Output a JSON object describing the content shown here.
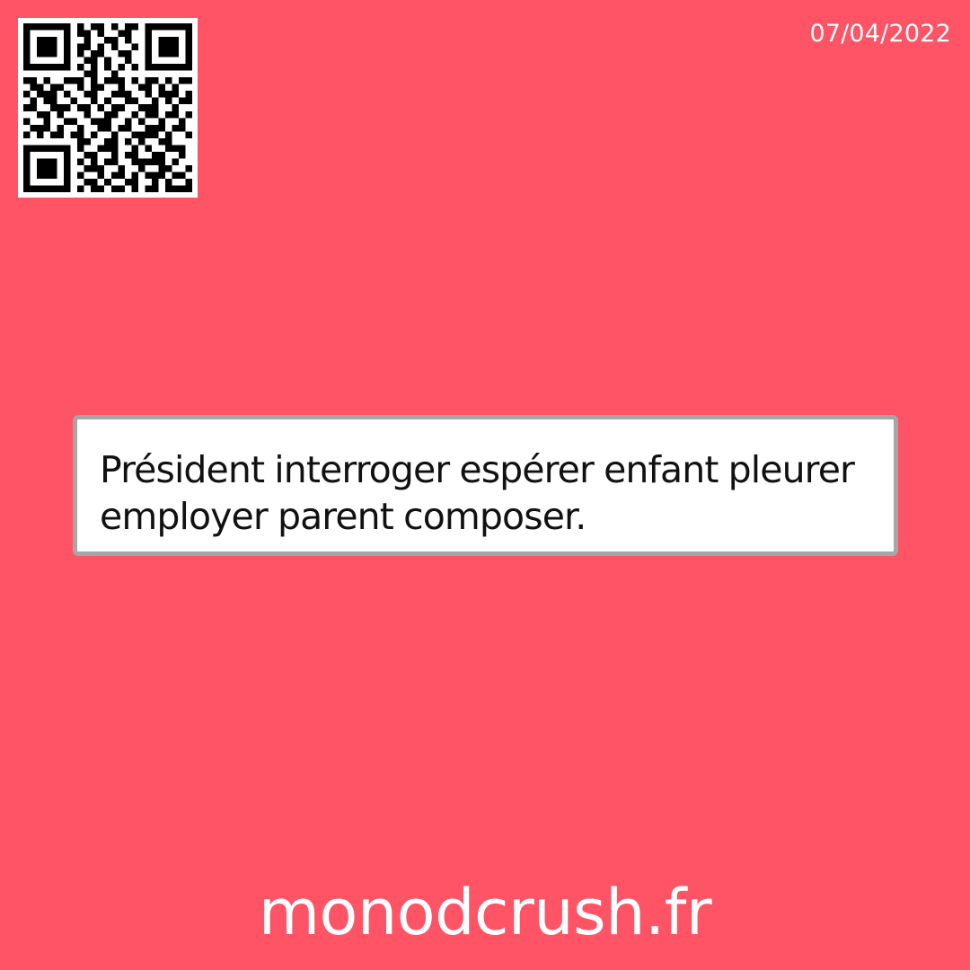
{
  "header": {
    "date": "07/04/2022"
  },
  "qr_code": {
    "icon": "qr-code-icon"
  },
  "message": {
    "text": "Président interroger espérer enfant pleurer employer parent composer."
  },
  "footer": {
    "site": "monodcrush.fr"
  },
  "colors": {
    "background": "#ff5366",
    "card_background": "#ffffff",
    "card_border": "#a6a6a6",
    "text_light": "#ffffff",
    "text_dark": "#111111"
  }
}
